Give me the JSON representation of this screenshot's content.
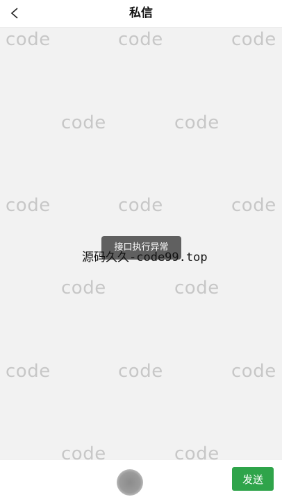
{
  "header": {
    "title": "私信",
    "back_icon": "chevron-left-icon"
  },
  "watermark": {
    "text": "code",
    "color": "#c4c4c4"
  },
  "toast": {
    "message": "接口执行异常"
  },
  "overlay": {
    "text": "源码久久-code99.top"
  },
  "input_bar": {
    "send_label": "发送",
    "voice_icon": "voice-record-icon",
    "send_color": "#2fa44a"
  }
}
